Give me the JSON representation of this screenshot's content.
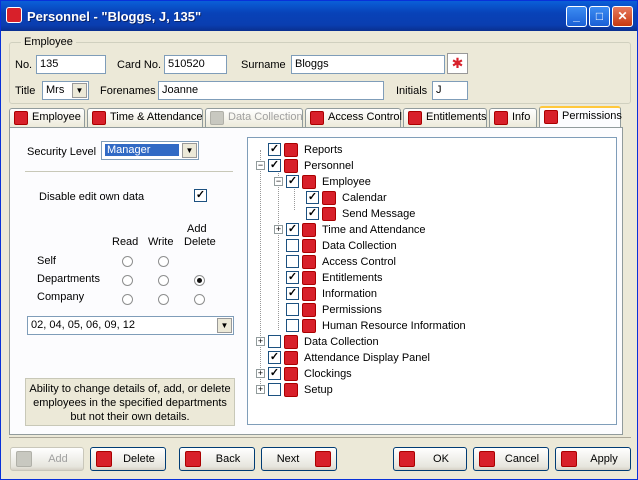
{
  "window": {
    "title": "Personnel - \"Bloggs, J, 135\""
  },
  "employee_group": {
    "label": "Employee"
  },
  "fields": {
    "no_label": "No.",
    "no_value": "135",
    "card_label": "Card No.",
    "card_value": "510520",
    "surname_label": "Surname",
    "surname_value": "Bloggs",
    "title_label": "Title",
    "title_value": "Mrs",
    "forenames_label": "Forenames",
    "forenames_value": "Joanne",
    "initials_label": "Initials",
    "initials_value": "J"
  },
  "tabs": [
    {
      "label": "Employee"
    },
    {
      "label": "Time & Attendance"
    },
    {
      "label": "Data Collection",
      "disabled": true
    },
    {
      "label": "Access Control"
    },
    {
      "label": "Entitlements"
    },
    {
      "label": "Info"
    },
    {
      "label": "Permissions",
      "active": true
    }
  ],
  "permissions": {
    "security_level_label": "Security Level",
    "security_level_value": "Manager",
    "disable_edit_label": "Disable edit own data",
    "disable_edit_checked": true,
    "col_read": "Read",
    "col_write": "Write",
    "col_add": "Add",
    "col_delete": "Delete",
    "rows": [
      {
        "label": "Self",
        "read": false,
        "write": false,
        "adddelete": null
      },
      {
        "label": "Departments",
        "read": false,
        "write": false,
        "adddelete": true
      },
      {
        "label": "Company",
        "read": false,
        "write": false,
        "adddelete": false
      }
    ],
    "departments_value": "02, 04, 05, 06, 09, 12",
    "description": "Ability to change details of, add, or delete employees in the specified departments but not their own details."
  },
  "tree": [
    {
      "label": "Reports",
      "checked": true,
      "level": 0
    },
    {
      "label": "Personnel",
      "checked": true,
      "level": 0,
      "expander": "-"
    },
    {
      "label": "Employee",
      "checked": true,
      "level": 1,
      "expander": "-"
    },
    {
      "label": "Calendar",
      "checked": true,
      "level": 2
    },
    {
      "label": "Send Message",
      "checked": true,
      "level": 2
    },
    {
      "label": "Time and Attendance",
      "checked": true,
      "level": 1,
      "expander": "+"
    },
    {
      "label": "Data Collection",
      "checked": false,
      "level": 1
    },
    {
      "label": "Access Control",
      "checked": false,
      "level": 1
    },
    {
      "label": "Entitlements",
      "checked": true,
      "level": 1
    },
    {
      "label": "Information",
      "checked": true,
      "level": 1
    },
    {
      "label": "Permissions",
      "checked": false,
      "level": 1
    },
    {
      "label": "Human Resource Information",
      "checked": false,
      "level": 1
    },
    {
      "label": "Data Collection",
      "checked": false,
      "level": 0,
      "expander": "+"
    },
    {
      "label": "Attendance Display Panel",
      "checked": true,
      "level": 0
    },
    {
      "label": "Clockings",
      "checked": true,
      "level": 0,
      "expander": "+"
    },
    {
      "label": "Setup",
      "checked": false,
      "level": 0,
      "expander": "+"
    }
  ],
  "buttons": {
    "add": "Add",
    "delete": "Delete",
    "back": "Back",
    "next": "Next",
    "ok": "OK",
    "cancel": "Cancel",
    "apply": "Apply"
  }
}
